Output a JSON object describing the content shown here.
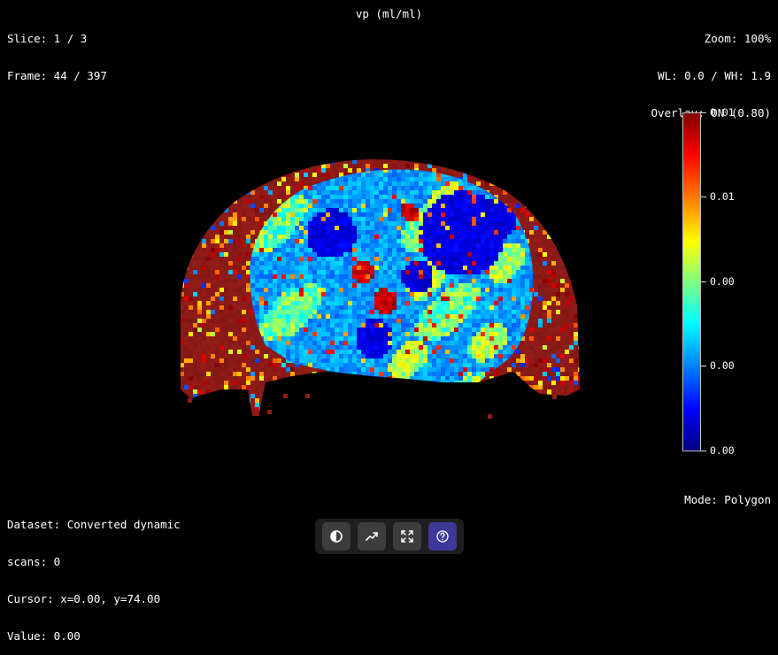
{
  "header": {
    "slice": "Slice: 1 / 3",
    "frame": "Frame: 44 / 397",
    "map_title": "vp (ml/ml)",
    "zoom": "Zoom: 100%",
    "window": "WL: 0.0 / WH: 1.9",
    "overlay": "Overlay: ON (0.80)"
  },
  "colorbar": {
    "colormap": "jet",
    "labels": [
      "0.01",
      "0.01",
      "0.00",
      "0.00",
      "0.00"
    ]
  },
  "footer": {
    "dataset_line1": "Dataset: Converted dynamic",
    "dataset_line2": "scans: 0",
    "cursor": "Cursor: x=0.00, y=74.00",
    "value": "Value: 0.00",
    "mode": "Mode: Polygon"
  },
  "toolbar": {
    "buttons": [
      {
        "icon": "contrast-icon",
        "active": false
      },
      {
        "icon": "trend-chart-icon",
        "active": false
      },
      {
        "icon": "fullscreen-icon",
        "active": false
      },
      {
        "icon": "help-icon",
        "active": true
      }
    ]
  },
  "colors": {
    "background": "#000000",
    "text": "#ffffff",
    "toolbar_bg": "#1e1e1e",
    "button_bg": "#3d3d3d",
    "button_active": "#3d3899"
  }
}
